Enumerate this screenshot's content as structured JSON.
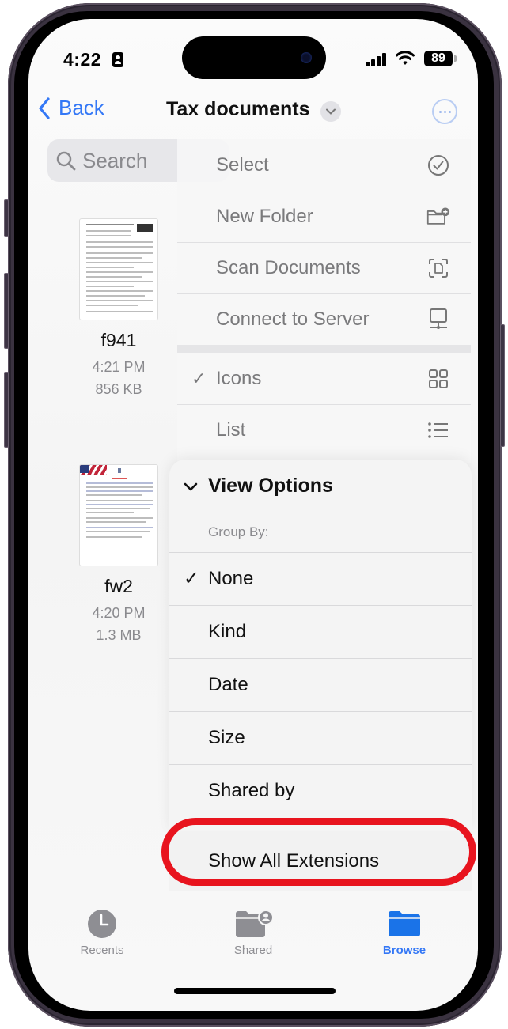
{
  "status_bar": {
    "time": "4:22",
    "battery": "89"
  },
  "nav": {
    "back_label": "Back",
    "title": "Tax documents"
  },
  "search": {
    "placeholder": "Search"
  },
  "files": [
    {
      "name": "f941",
      "time": "4:21 PM",
      "size": "856 KB"
    },
    {
      "name": "fw2",
      "time": "4:20 PM",
      "size": "1.3 MB"
    }
  ],
  "menu": {
    "actions": [
      {
        "label": "Select",
        "icon": "checkmark-circle-icon"
      },
      {
        "label": "New Folder",
        "icon": "folder-badge-plus-icon"
      },
      {
        "label": "Scan Documents",
        "icon": "doc-viewfinder-icon"
      },
      {
        "label": "Connect to Server",
        "icon": "server-display-icon"
      }
    ],
    "view_modes": [
      {
        "label": "Icons",
        "checked": true,
        "icon": "grid-icon"
      },
      {
        "label": "List",
        "checked": false,
        "icon": "list-icon"
      }
    ],
    "view_options": {
      "header": "View Options",
      "group_by_label": "Group By:",
      "group_options": [
        {
          "label": "None",
          "checked": true
        },
        {
          "label": "Kind",
          "checked": false
        },
        {
          "label": "Date",
          "checked": false
        },
        {
          "label": "Size",
          "checked": false
        },
        {
          "label": "Shared by",
          "checked": false
        }
      ],
      "show_extensions": "Show All Extensions"
    },
    "check_glyph": "✓"
  },
  "tabbar": {
    "tabs": [
      {
        "label": "Recents",
        "active": false
      },
      {
        "label": "Shared",
        "active": false
      },
      {
        "label": "Browse",
        "active": true
      }
    ]
  },
  "colors": {
    "accent": "#3478f6",
    "highlight_ring": "#e8141e"
  }
}
